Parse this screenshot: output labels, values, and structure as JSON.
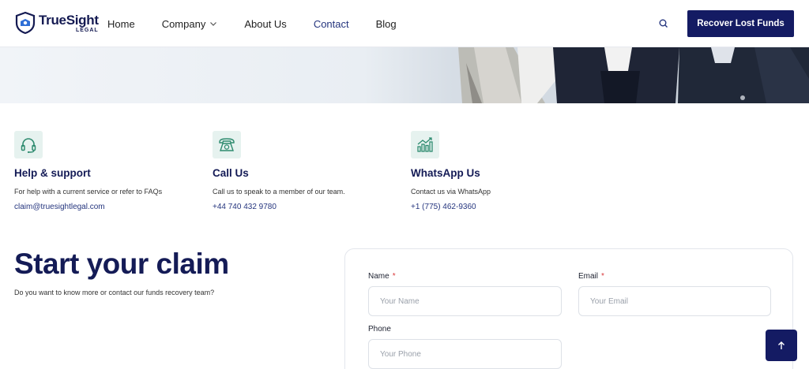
{
  "header": {
    "logo_name": "TrueSight",
    "logo_sub": "LEGAL",
    "nav": [
      {
        "label": "Home"
      },
      {
        "label": "Company"
      },
      {
        "label": "About Us"
      },
      {
        "label": "Contact"
      },
      {
        "label": "Blog"
      }
    ],
    "active_nav": "Contact",
    "cta_label": "Recover Lost Funds"
  },
  "contact_cards": [
    {
      "icon": "headset-icon",
      "title": "Help & support",
      "text": "For help with a current service or refer to FAQs",
      "link": "claim@truesightlegal.com"
    },
    {
      "icon": "telephone-icon",
      "title": "Call Us",
      "text": "Call us to speak to a member of our team.",
      "link": "+44 740 432 9780"
    },
    {
      "icon": "bar-chart-icon",
      "title": "WhatsApp Us",
      "text": "Contact us via WhatsApp",
      "link": "+1 (775) 462-9360"
    }
  ],
  "claim": {
    "title": "Start your claim",
    "subtitle": "Do you want to know more or contact our funds recovery team?"
  },
  "form": {
    "name_label": "Name",
    "name_placeholder": "Your Name",
    "email_label": "Email",
    "email_placeholder": "Your Email",
    "phone_label": "Phone",
    "phone_placeholder": "Your Phone",
    "required_mark": "*"
  },
  "colors": {
    "brand": "#141b63",
    "accent": "#25357e",
    "icon_bg": "#e6f2ef",
    "icon_green": "#2e8b6f"
  }
}
